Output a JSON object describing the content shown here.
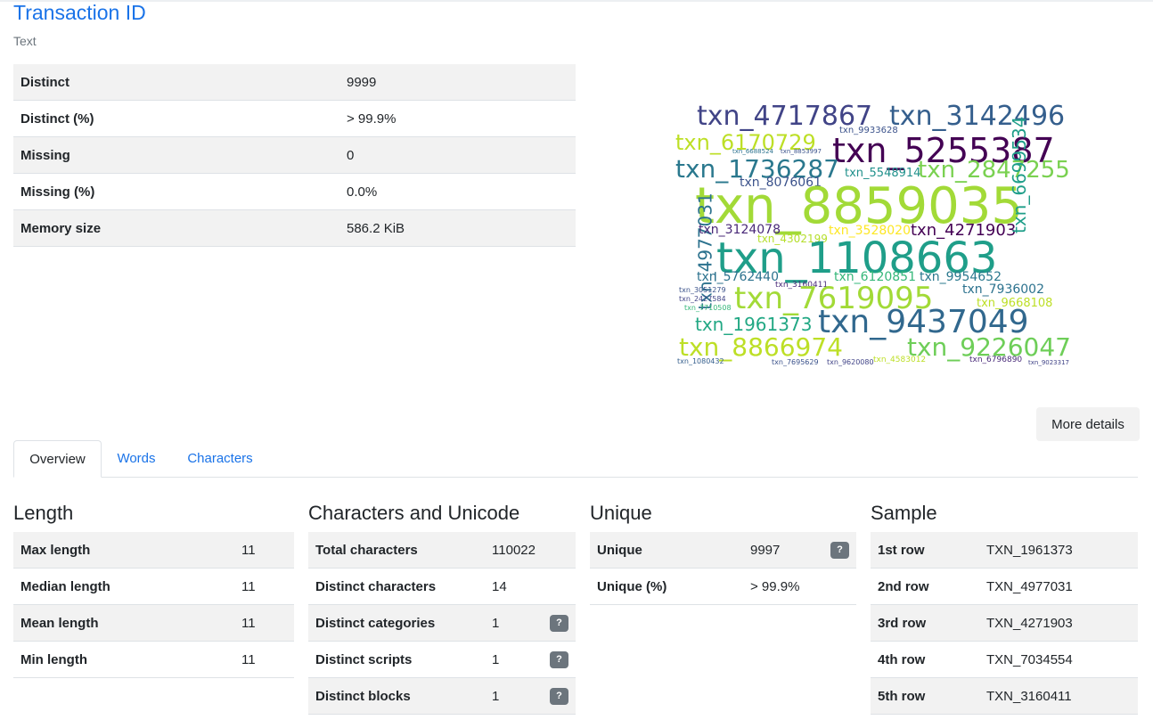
{
  "variable": {
    "name": "Transaction ID",
    "type": "Text"
  },
  "stats": [
    {
      "key": "Distinct",
      "value": "9999"
    },
    {
      "key": "Distinct (%)",
      "value": "> 99.9%"
    },
    {
      "key": "Missing",
      "value": "0"
    },
    {
      "key": "Missing (%)",
      "value": "0.0%"
    },
    {
      "key": "Memory size",
      "value": "586.2 KiB"
    }
  ],
  "wordcloud": [
    {
      "text": "txn_4717867",
      "c": "#414487"
    },
    {
      "text": "txn_3142496",
      "c": "#355f8d"
    },
    {
      "text": "txn_6170729",
      "c": "#bddf26"
    },
    {
      "text": "txn_9933628",
      "c": "#3b528b"
    },
    {
      "text": "txn_5255387",
      "c": "#440154"
    },
    {
      "text": "txn_1736287",
      "c": "#2a788e"
    },
    {
      "text": "txn_5548914",
      "c": "#21918c"
    },
    {
      "text": "txn_2847255",
      "c": "#7ad151"
    },
    {
      "text": "txn_8076061",
      "c": "#3b528b"
    },
    {
      "text": "txn_8859035",
      "c": "#a2da37"
    },
    {
      "text": "txn_4977031",
      "c": "#2c728e"
    },
    {
      "text": "txn_3124078",
      "c": "#482878"
    },
    {
      "text": "txn_4302199",
      "c": "#b5de2b"
    },
    {
      "text": "txn_3528020",
      "c": "#fde725"
    },
    {
      "text": "txn_4271903",
      "c": "#440154"
    },
    {
      "text": "txn_6699534",
      "c": "#1f9e89"
    },
    {
      "text": "txn_1108663",
      "c": "#1f9e89"
    },
    {
      "text": "txn_5762440",
      "c": "#2c728e"
    },
    {
      "text": "txn_6120851",
      "c": "#35b779"
    },
    {
      "text": "txn_9954652",
      "c": "#2a788e"
    },
    {
      "text": "txn_3160411",
      "c": "#482878"
    },
    {
      "text": "txn_7619095",
      "c": "#a2da37"
    },
    {
      "text": "txn_7936002",
      "c": "#2c728e"
    },
    {
      "text": "txn_9668108",
      "c": "#bddf26"
    },
    {
      "text": "txn_3051279",
      "c": "#3b528b"
    },
    {
      "text": "txn_2427584",
      "c": "#414487"
    },
    {
      "text": "txn_7710508",
      "c": "#35b779"
    },
    {
      "text": "txn_1961373",
      "c": "#22a884"
    },
    {
      "text": "txn_9437049",
      "c": "#31688e"
    },
    {
      "text": "txn_8866974",
      "c": "#bddf26"
    },
    {
      "text": "txn_9226047",
      "c": "#6ece58"
    },
    {
      "text": "txn_1080432",
      "c": "#355f8d"
    },
    {
      "text": "txn_7695629",
      "c": "#3b528b"
    },
    {
      "text": "txn_9620080",
      "c": "#414487"
    },
    {
      "text": "txn_4583012",
      "c": "#bddf26"
    },
    {
      "text": "txn_6796890",
      "c": "#482878"
    },
    {
      "text": "txn_8853997",
      "c": "#3b528b"
    },
    {
      "text": "txn_6688524",
      "c": "#2c728e"
    },
    {
      "text": "txn_9023317",
      "c": "#414487"
    }
  ],
  "more_details": "More details",
  "tabs": [
    {
      "label": "Overview"
    },
    {
      "label": "Words"
    },
    {
      "label": "Characters"
    }
  ],
  "sections": {
    "length": {
      "title": "Length",
      "rows": [
        {
          "key": "Max length",
          "value": "11"
        },
        {
          "key": "Median length",
          "value": "11"
        },
        {
          "key": "Mean length",
          "value": "11"
        },
        {
          "key": "Min length",
          "value": "11"
        }
      ]
    },
    "unicode": {
      "title": "Characters and Unicode",
      "rows": [
        {
          "key": "Total characters",
          "value": "110022",
          "help": ""
        },
        {
          "key": "Distinct characters",
          "value": "14",
          "help": ""
        },
        {
          "key": "Distinct categories",
          "value": "1",
          "help": "?"
        },
        {
          "key": "Distinct scripts",
          "value": "1",
          "help": "?"
        },
        {
          "key": "Distinct blocks",
          "value": "1",
          "help": "?"
        }
      ]
    },
    "unique": {
      "title": "Unique",
      "rows": [
        {
          "key": "Unique",
          "value": "9997",
          "help": "?"
        },
        {
          "key": "Unique (%)",
          "value": "> 99.9%",
          "help": ""
        }
      ]
    },
    "sample": {
      "title": "Sample",
      "rows": [
        {
          "key": "1st row",
          "value": "TXN_1961373"
        },
        {
          "key": "2nd row",
          "value": "TXN_4977031"
        },
        {
          "key": "3rd row",
          "value": "TXN_4271903"
        },
        {
          "key": "4th row",
          "value": "TXN_7034554"
        },
        {
          "key": "5th row",
          "value": "TXN_3160411"
        }
      ]
    }
  }
}
